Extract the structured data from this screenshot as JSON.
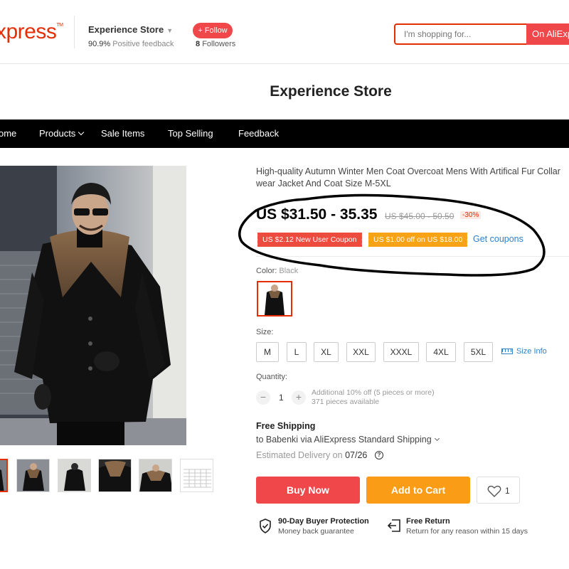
{
  "header": {
    "logo": "xpress",
    "logo_tm": "TM",
    "store_name": "Experience Store",
    "feedback_pct": "90.9%",
    "feedback_label": "Positive feedback",
    "follow_label": "+ Follow",
    "followers_count": "8",
    "followers_label": "Followers",
    "search_placeholder": "I'm shopping for...",
    "search_button": "On AliExp"
  },
  "store_title": "Experience Store",
  "nav": {
    "items": [
      "ome",
      "Products",
      "Sale Items",
      "Top Selling",
      "Feedback"
    ]
  },
  "product": {
    "title": "High-quality Autumn Winter Men Coat Overcoat Mens With Artifical Fur Collar wear Jacket And Coat Size M-5XL",
    "price": "US $31.50 - 35.35",
    "original_price": "US $45.00 - 50.50",
    "discount": "-30%",
    "coupons": [
      "US $2.12 New User Coupon",
      "US $1.00 off on US $18.00"
    ],
    "get_coupons": "Get coupons",
    "color_label": "Color:",
    "color_value": "Black",
    "size_label": "Size:",
    "sizes": [
      "M",
      "L",
      "XL",
      "XXL",
      "XXXL",
      "4XL",
      "5XL"
    ],
    "size_info": "Size Info",
    "quantity_label": "Quantity:",
    "quantity": "1",
    "qty_minus": "−",
    "qty_plus": "+",
    "qty_note_1": "Additional 10% off (5 pieces or more)",
    "qty_note_2": "371 pieces available",
    "shipping_title": "Free Shipping",
    "shipping_via": "to Babenki via AliExpress Standard Shipping",
    "delivery_label": "Estimated Delivery on",
    "delivery_date": "07/26",
    "buy_now": "Buy Now",
    "add_to_cart": "Add to Cart",
    "wishlist_count": "1",
    "guarantees": [
      {
        "title": "90-Day Buyer Protection",
        "subtitle": "Money back guarantee"
      },
      {
        "title": "Free Return",
        "subtitle": "Return for any reason within 15 days"
      }
    ]
  },
  "colors": {
    "brand_red": "#e62e04",
    "button_red": "#f0484a",
    "button_orange": "#fb9c17",
    "link_blue": "#2e81c9",
    "nav_bg": "#000000"
  }
}
